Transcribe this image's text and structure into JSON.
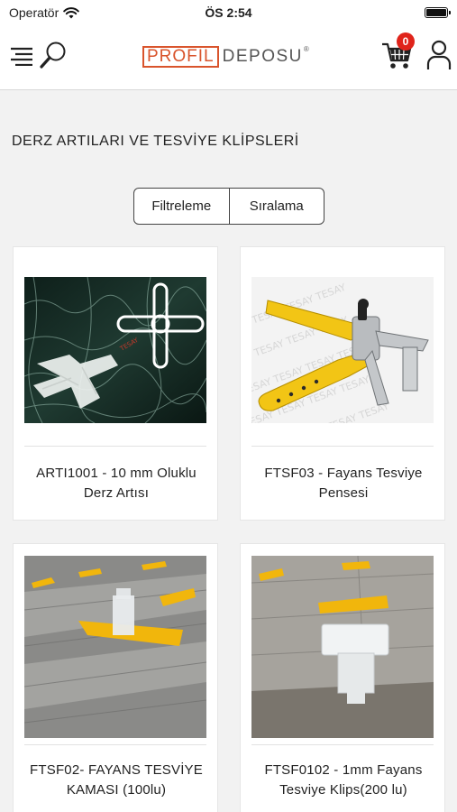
{
  "status_bar": {
    "carrier": "Operatör",
    "time": "ÖS 2:54"
  },
  "header": {
    "logo_part1": "PROFIL",
    "logo_part2": "DEPOSU",
    "logo_reg": "®",
    "cart_count": "0"
  },
  "category": {
    "title": "DERZ ARTILARI VE TESVİYE KLİPSLERİ"
  },
  "controls": {
    "filter_label": "Filtreleme",
    "sort_label": "Sıralama"
  },
  "products": [
    {
      "name": "ARTI1001 - 10 mm Oluklu Derz Artısı"
    },
    {
      "name": "FTSF03 - Fayans Tesviye Pensesi"
    },
    {
      "name": "FTSF02- FAYANS TESVİYE KAMASI (100lu)"
    },
    {
      "name": "FTSF0102 - 1mm Fayans Tesviye Klips(200 lu)"
    }
  ],
  "colors": {
    "accent": "#d9542c",
    "badge": "#e0241b"
  }
}
